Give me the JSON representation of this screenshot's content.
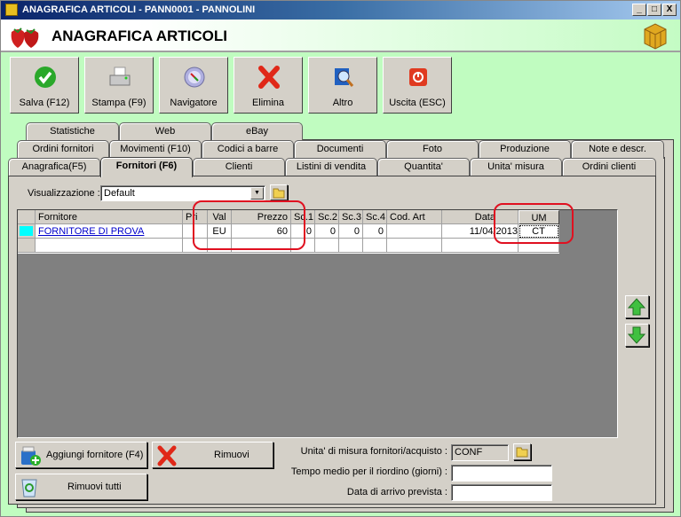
{
  "window": {
    "title": "ANAGRAFICA ARTICOLI - PANN0001 - PANNOLINI",
    "controls": [
      "_",
      "□",
      "X"
    ]
  },
  "header": {
    "title": "ANAGRAFICA ARTICOLI"
  },
  "toolbar": [
    {
      "label": "Salva (F12)",
      "icon": "check-icon"
    },
    {
      "label": "Stampa (F9)",
      "icon": "printer-icon"
    },
    {
      "label": "Navigatore",
      "icon": "compass-icon"
    },
    {
      "label": "Elimina",
      "icon": "delete-x-icon"
    },
    {
      "label": "Altro",
      "icon": "book-magnifier-icon"
    },
    {
      "label": "Uscita (ESC)",
      "icon": "power-icon"
    }
  ],
  "tabs": {
    "row1": [
      "Statistiche",
      "Web",
      "eBay"
    ],
    "row2": [
      "Ordini fornitori",
      "Movimenti (F10)",
      "Codici a barre",
      "Documenti",
      "Foto",
      "Produzione",
      "Note e descr."
    ],
    "row3": [
      "Anagrafica(F5)",
      "Fornitori (F6)",
      "Clienti",
      "Listini di vendita",
      "Quantita'",
      "Unita' misura",
      "Ordini clienti"
    ],
    "selected": "Fornitori (F6)"
  },
  "view": {
    "label": "Visualizzazione :",
    "value": "Default"
  },
  "grid": {
    "columns": [
      "Fornitore",
      "Pri",
      "Val",
      "Prezzo",
      "Sc.1",
      "Sc.2",
      "Sc.3",
      "Sc.4",
      "Cod. Art",
      "Data",
      "UM"
    ],
    "rows": [
      [
        "FORNITORE DI PROVA",
        "",
        "EU",
        "60",
        "0",
        "0",
        "0",
        "0",
        "",
        "11/04/2013",
        "CT"
      ]
    ]
  },
  "buttons": {
    "add": "Aggiungi fornitore (F4)",
    "remove": "Rimuovi",
    "remove_all": "Rimuovi tutti"
  },
  "fields": {
    "um_label": "Unita' di misura fornitori/acquisto :",
    "um_value": "CONF",
    "tempo_label": "Tempo medio per il riordino (giorni) :",
    "tempo_value": "",
    "data_label": "Data di arrivo prevista :",
    "data_value": ""
  },
  "colors": {
    "background": "#c0fcc0",
    "panel": "#d4d0c8",
    "grid_bg": "#808080",
    "highlight": "#e01020",
    "link": "#0000cc",
    "row_indicator": "#00ffff"
  }
}
